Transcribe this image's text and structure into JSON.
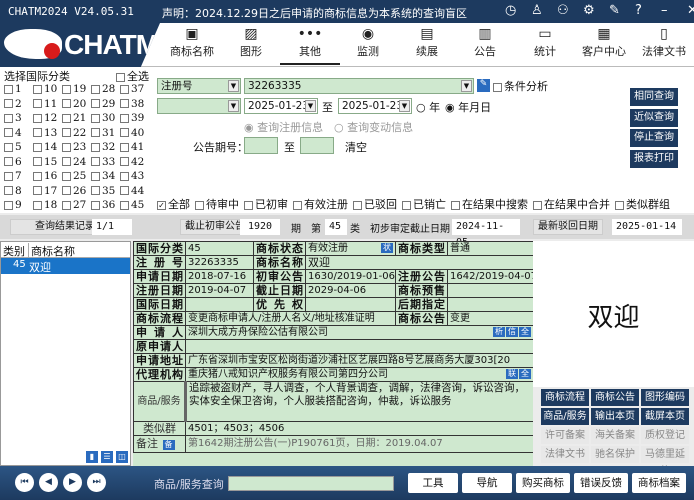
{
  "window": {
    "title": "CHATM2024 V24.05.31",
    "notice": "声明：2024.12.29日之后申请的商标信息为本系统的查询盲区",
    "controls": [
      "clock-icon",
      "shirt-icon",
      "users-icon",
      "gear-icon",
      "edit-icon",
      "help-icon",
      "minimize-icon",
      "close-icon"
    ],
    "control_glyphs": [
      "◷",
      "♙",
      "⚇",
      "⚙",
      "✎",
      "?",
      "–",
      "✕"
    ]
  },
  "logo": {
    "text": "CHATM"
  },
  "nav": [
    {
      "label": "商标名称",
      "icon": "▣"
    },
    {
      "label": "图形",
      "icon": "▨"
    },
    {
      "label": "其他",
      "icon": "•••",
      "active": true
    },
    {
      "label": "监测",
      "icon": "◉"
    },
    {
      "label": "续展",
      "icon": "▤"
    },
    {
      "label": "公告",
      "icon": "▥"
    },
    {
      "label": "统计",
      "icon": "▭"
    },
    {
      "label": "客户中心",
      "icon": "▦"
    },
    {
      "label": "法律文书",
      "icon": "▯"
    }
  ],
  "classes": {
    "title": "选择国际分类",
    "select_all": "全选",
    "numbers": [
      "1",
      "2",
      "3",
      "4",
      "5",
      "6",
      "7",
      "8",
      "9",
      "10",
      "11",
      "12",
      "13",
      "14",
      "15",
      "16",
      "17",
      "18",
      "19",
      "20",
      "21",
      "22",
      "23",
      "24",
      "25",
      "26",
      "27",
      "28",
      "29",
      "30",
      "31",
      "32",
      "33",
      "34",
      "35",
      "36",
      "37",
      "38",
      "39",
      "40",
      "41",
      "42",
      "43",
      "44",
      "45"
    ]
  },
  "query": {
    "field_type": "注册号",
    "field_value": "32263335",
    "condition_analysis": "条件分析",
    "date_type": "",
    "date_from": "2025-01-23",
    "to": "至",
    "date_to": "2025-01-23",
    "year": "年",
    "ymd": "年月日",
    "reg_info": "查询注册信息",
    "change_info": "查询变动信息",
    "gazette_label": "公告期号：",
    "gazette_from": "",
    "gazette_to": "",
    "clear": "清空",
    "buttons": [
      "相同查询",
      "近似查询",
      "停止查询",
      "报表打印"
    ],
    "filters": [
      {
        "label": "全部",
        "checked": true
      },
      {
        "label": "待审中"
      },
      {
        "label": "已初审"
      },
      {
        "label": "有效注册"
      },
      {
        "label": "已驳回"
      },
      {
        "label": "已销亡"
      },
      {
        "label": "在结果中搜索"
      },
      {
        "label": "在结果中合并"
      },
      {
        "label": "类似群组"
      }
    ]
  },
  "status": {
    "records_label": "查询结果记录数",
    "records": "1/1",
    "cutoff_label": "截止初审公告",
    "cutoff": "1920",
    "period": "期",
    "di": "第",
    "cls": "45",
    "lei": "类",
    "prelim_label": "初步审定截止日期",
    "prelim": "2024-11-05",
    "reject_label": "最新驳回日期",
    "reject": "2025-01-14"
  },
  "list": {
    "headers": [
      "类别",
      "商标名称"
    ],
    "rows": [
      {
        "cls": "45",
        "name": "双迎"
      }
    ]
  },
  "detail": {
    "l_cls": "国际分类",
    "cls": "45",
    "l_status": "商标状态",
    "status": "有效注册",
    "status_tag": "状",
    "l_type": "商标类型",
    "type": "普通",
    "l_regno": "注册号",
    "regno": "32263335",
    "l_name": "商标名称",
    "name": "双迎",
    "l_appdate": "申请日期",
    "appdate": "2018-07-16",
    "l_prelim": "初审公告",
    "prelim": "1630/2019-01-06",
    "l_regpub": "注册公告",
    "regpub": "1642/2019-04-07",
    "l_regdate": "注册日期",
    "regdate": "2019-04-07",
    "l_expire": "截止日期",
    "expire": "2029-04-06",
    "l_presale": "商标预售",
    "presale": "",
    "l_intdate": "国际日期",
    "intdate": "",
    "l_priority": "优先权",
    "priority": "",
    "l_later": "后期指定",
    "later": "",
    "l_flow": "商标流程",
    "flow": "变更商标申请人/注册人名义/地址核准证明",
    "l_notice": "商标公告",
    "notice": "变更",
    "l_applicant": "申请人",
    "applicant": "深圳大成方舟保险公估有限公司",
    "applicant_tags": [
      "析",
      "信",
      "全"
    ],
    "l_orig": "原申请人",
    "orig": "",
    "l_addr": "申请地址",
    "addr": "广东省深圳市宝安区松岗街道沙浦社区艺展四路8号艺展商务大厦303[20",
    "l_agent": "代理机构",
    "agent": "重庆猪八戒知识产权服务有限公司第四分公司",
    "agent_tags": [
      "联",
      "全"
    ],
    "l_goods": "商品/服务",
    "goods": "追踪被盗财产，寻人调查，个人背景调查，调解，法律咨询，诉讼咨询，实体安全保卫咨询，个人服装搭配咨询，仲裁，诉讼服务",
    "l_group": "类似群",
    "group": "4501；4503；4506",
    "l_remark": "备注",
    "remark_tag": "备",
    "remark": "第1642期注册公告(一)P190761页，日期：2019.04.07"
  },
  "mark_image": "双迎",
  "right_buttons": [
    {
      "label": "商标流程",
      "on": true
    },
    {
      "label": "商标公告",
      "on": true
    },
    {
      "label": "图形编码",
      "on": true
    },
    {
      "label": "商品/服务",
      "on": true
    },
    {
      "label": "输出本页",
      "on": true
    },
    {
      "label": "截屏本页",
      "on": true
    },
    {
      "label": "许可备案"
    },
    {
      "label": "海关备案"
    },
    {
      "label": "质权登记"
    },
    {
      "label": "法律文书"
    },
    {
      "label": "驰名保护"
    },
    {
      "label": "马德里延伸"
    }
  ],
  "view_icons": [
    "bar-chart-icon",
    "list-icon",
    "grid-icon"
  ],
  "bottom": {
    "goods_query_label": "商品/服务查询",
    "goods_query_value": "",
    "buttons": [
      "工具",
      "导航",
      "购买商标",
      "错误反馈",
      "商标档案"
    ],
    "pager": [
      "first-icon",
      "prev-icon",
      "next-icon",
      "last-icon"
    ]
  }
}
